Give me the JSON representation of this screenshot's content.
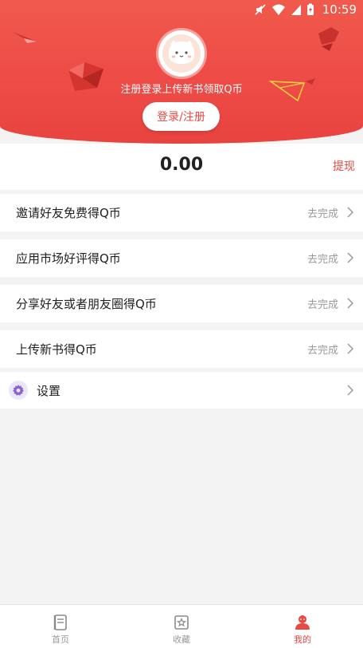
{
  "status_bar": {
    "time": "10:59"
  },
  "header": {
    "promo_text": "注册登录上传新书领取Q币",
    "login_button": "登录/注册"
  },
  "balance": {
    "value": "0.00",
    "withdraw_label": "提现"
  },
  "tasks": [
    {
      "label": "邀请好友免费得Q币",
      "status": "去完成"
    },
    {
      "label": "应用市场好评得Q币",
      "status": "去完成"
    },
    {
      "label": "分享好友或者朋友圈得Q币",
      "status": "去完成"
    },
    {
      "label": "上传新书得Q币",
      "status": "去完成"
    }
  ],
  "settings": {
    "label": "设置",
    "icon": "gear-icon"
  },
  "tabbar": {
    "items": [
      {
        "label": "首页",
        "icon": "book-icon",
        "active": false
      },
      {
        "label": "收藏",
        "icon": "star-box-icon",
        "active": false
      },
      {
        "label": "我的",
        "icon": "user-icon",
        "active": true
      }
    ]
  },
  "colors": {
    "accent": "#e84a42",
    "header": "#ee4a46",
    "background": "#f3f3f3"
  }
}
